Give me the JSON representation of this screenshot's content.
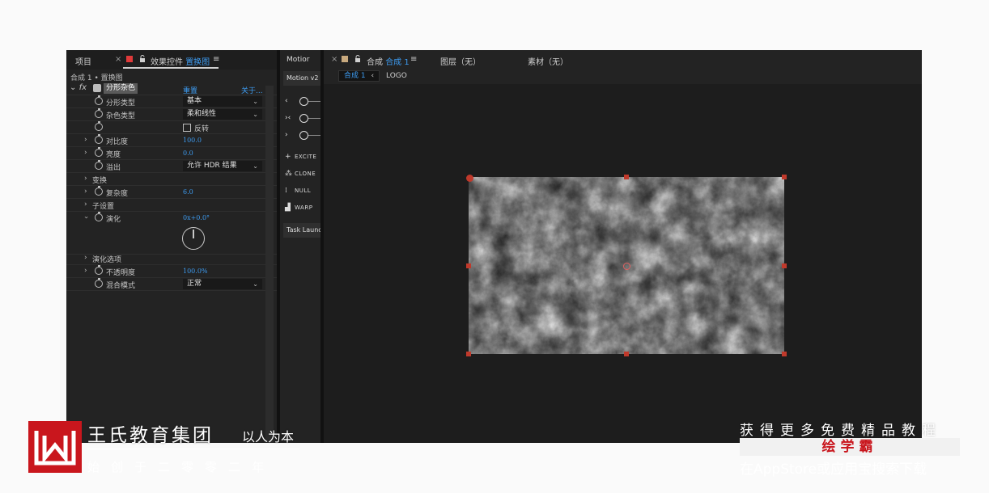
{
  "effect_controls": {
    "project_tab": "项目",
    "close_glyph": "×",
    "tab_label": "效果控件",
    "tab_layer": "置换图",
    "menu_glyph": "≡",
    "breadcrumb": "合成 1 • 置换图",
    "effect": {
      "fx": "fx",
      "name": "分形杂色",
      "reset": "重置",
      "about": "关于..."
    },
    "rows": {
      "fractal_type": {
        "label": "分形类型",
        "value": "基本"
      },
      "noise_type": {
        "label": "杂色类型",
        "value": "柔和线性"
      },
      "invert": {
        "label": "反转"
      },
      "contrast": {
        "label": "对比度",
        "value": "100.0"
      },
      "brightness": {
        "label": "亮度",
        "value": "0.0"
      },
      "overflow": {
        "label": "溢出",
        "value": "允许 HDR 结果"
      },
      "transform": {
        "label": "变换"
      },
      "complexity": {
        "label": "复杂度",
        "value": "6.0"
      },
      "sub_settings": {
        "label": "子设置"
      },
      "evolution": {
        "label": "演化",
        "value": "0x+0.0°"
      },
      "evolution_options": {
        "label": "演化选项"
      },
      "opacity": {
        "label": "不透明度",
        "value": "100.0%"
      },
      "blend_mode": {
        "label": "混合模式",
        "value": "正常"
      }
    }
  },
  "motion_panel": {
    "tab": "Motior",
    "version_tab": "Motion v2",
    "buttons": [
      "EXCITE",
      "CLONE",
      "NULL",
      "WARP"
    ],
    "task_launcher": "Task Launc"
  },
  "composition": {
    "close_glyph": "×",
    "tab_prefix": "合成",
    "tab_name": "合成 1",
    "menu_glyph": "≡",
    "layer_tab": "图层（无）",
    "footage_tab": "素材（无）",
    "sub_active": "合成 1",
    "sub_logo": "LOGO"
  },
  "branding": {
    "company": "王氏教育集团",
    "slogan": "以人为本",
    "founded": "始创于二零零二年",
    "promo": "获得更多免费精品教程",
    "app_name": "绘学霸",
    "download": "在AppStore或应用宝搜索下载"
  },
  "colors": {
    "accent_blue": "#3d9bf0",
    "brand_red": "#c9161d",
    "panel_bg": "#232323"
  }
}
